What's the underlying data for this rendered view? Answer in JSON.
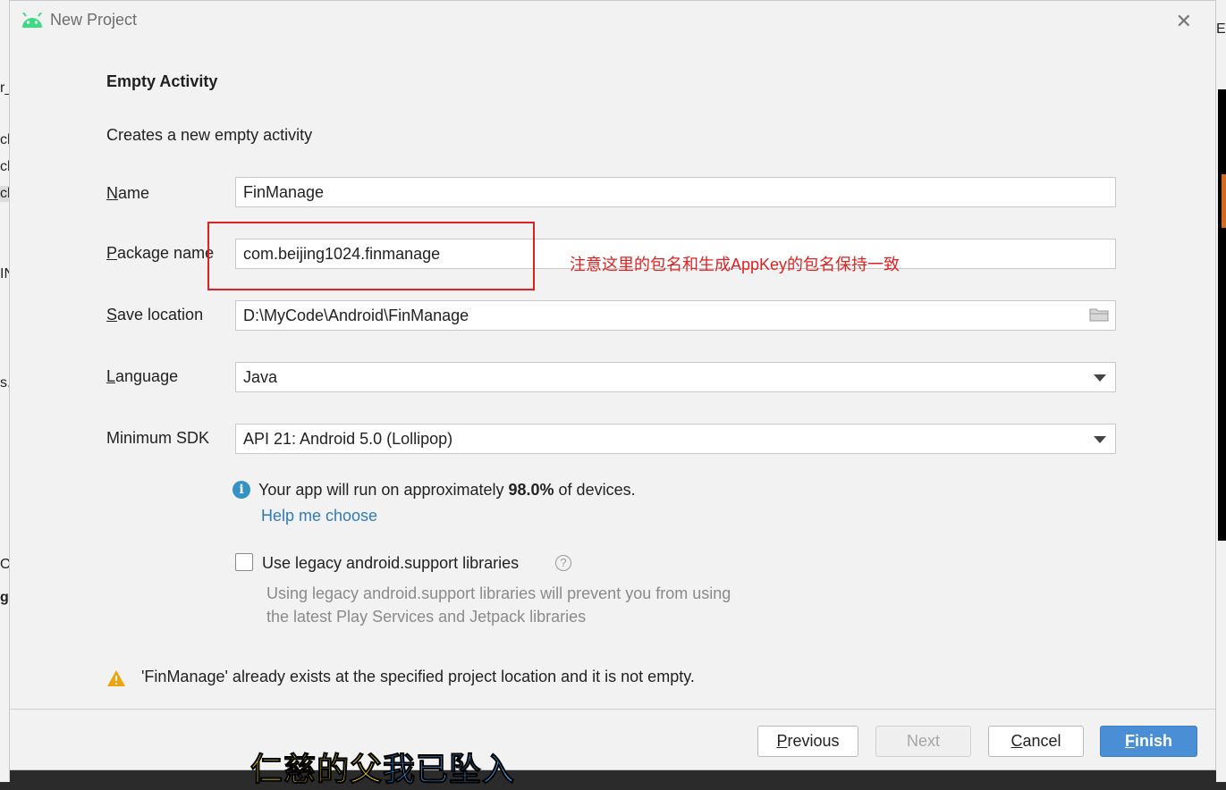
{
  "window": {
    "title": "New Project"
  },
  "page": {
    "heading": "Empty Activity",
    "subtitle": "Creates a new empty activity"
  },
  "form": {
    "name": {
      "label_key": "N",
      "label_rest": "ame",
      "value": "FinManage"
    },
    "package": {
      "label_key": "P",
      "label_rest": "ackage name",
      "value": "com.beijing1024.finmanage"
    },
    "save_location": {
      "label_key": "S",
      "label_rest": "ave location",
      "value": "D:\\MyCode\\Android\\FinManage"
    },
    "language": {
      "label_key": "L",
      "label_rest": "anguage",
      "value": "Java"
    },
    "min_sdk": {
      "label": "Minimum SDK",
      "value": "API 21: Android 5.0 (Lollipop)"
    }
  },
  "annotation": {
    "text": "注意这里的包名和生成AppKey的包名保持一致",
    "color": "#e02020"
  },
  "info": {
    "prefix": "Your app will run on approximately ",
    "percent": "98.0%",
    "suffix": " of devices.",
    "help_link": "Help me choose"
  },
  "legacy": {
    "label": "Use legacy android.support libraries",
    "checked": false,
    "note_line1": "Using legacy android.support libraries will prevent you from using",
    "note_line2": "the latest Play Services and Jetpack libraries"
  },
  "warning": {
    "text": "'FinManage' already exists at the specified project location and it is not empty."
  },
  "buttons": {
    "previous_key": "P",
    "previous_rest": "revious",
    "next": "Next",
    "cancel_key": "C",
    "cancel_rest": "ancel",
    "finish_key": "F",
    "finish_rest": "inish"
  },
  "video_subtitle": {
    "part1": "仁慈的父",
    "part2": "我已坠入"
  },
  "background": {
    "right_top": "Er",
    "left_frags": [
      "r_",
      "cl",
      "cl",
      "cl",
      "IN",
      "s.",
      "Ou",
      "g"
    ]
  },
  "colors": {
    "accent": "#4a8fd6",
    "link": "#2f7ab8",
    "warning": "#f0a30a",
    "info": "#3592c4",
    "android_green": "#3ddc84"
  }
}
